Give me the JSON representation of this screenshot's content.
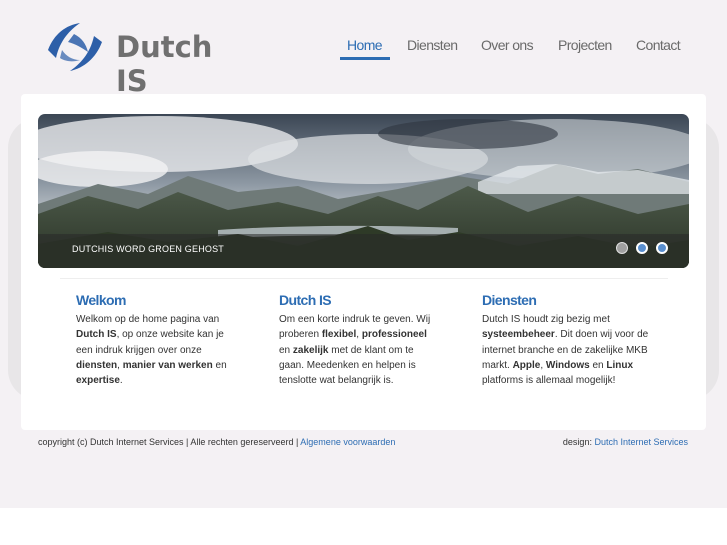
{
  "header": {
    "logo_text": "Dutch IS",
    "nav": [
      {
        "label": "Home",
        "active": true
      },
      {
        "label": "Diensten"
      },
      {
        "label": "Over ons"
      },
      {
        "label": "Projecten"
      },
      {
        "label": "Contact"
      }
    ]
  },
  "slider": {
    "caption": "DUTCHIS WORD GROEN GEHOST",
    "dots": 3,
    "active_dot": 2
  },
  "columns": [
    {
      "title": "Welkom",
      "parts": [
        {
          "t": "Welkom op de home pagina van "
        },
        {
          "t": "Dutch IS",
          "b": true
        },
        {
          "t": ", op onze website kan je een indruk krijgen over onze "
        },
        {
          "t": "diensten",
          "b": true
        },
        {
          "t": ", "
        },
        {
          "t": "manier van werken",
          "b": true
        },
        {
          "t": " en "
        },
        {
          "t": "expertise",
          "b": true
        },
        {
          "t": "."
        }
      ]
    },
    {
      "title": "Dutch IS",
      "parts": [
        {
          "t": "Om een korte indruk te geven. Wij proberen "
        },
        {
          "t": "flexibel",
          "b": true
        },
        {
          "t": ", "
        },
        {
          "t": "professioneel",
          "b": true
        },
        {
          "t": " en "
        },
        {
          "t": "zakelijk",
          "b": true
        },
        {
          "t": " met de klant om te gaan. Meedenken en helpen is tenslotte wat belangrijk is."
        }
      ]
    },
    {
      "title": "Diensten",
      "parts": [
        {
          "t": "Dutch IS houdt zig bezig met "
        },
        {
          "t": "systeembeheer",
          "b": true
        },
        {
          "t": ". Dit doen wij voor de internet branche en de zakelijke MKB markt. "
        },
        {
          "t": "Apple",
          "b": true
        },
        {
          "t": ", "
        },
        {
          "t": "Windows",
          "b": true
        },
        {
          "t": " en "
        },
        {
          "t": "Linux",
          "b": true
        },
        {
          "t": " platforms is allemaal mogelijk!"
        }
      ]
    }
  ],
  "footer": {
    "copyright": "copyright (c) Dutch Internet Services | Alle rechten gereserveerd | ",
    "terms_link": "Algemene voorwaarden",
    "design_label": "design: ",
    "design_link": "Dutch Internet Services"
  },
  "colors": {
    "accent": "#2d6db3",
    "background": "#f4f1f4",
    "nav_text": "#6a6a6a"
  }
}
